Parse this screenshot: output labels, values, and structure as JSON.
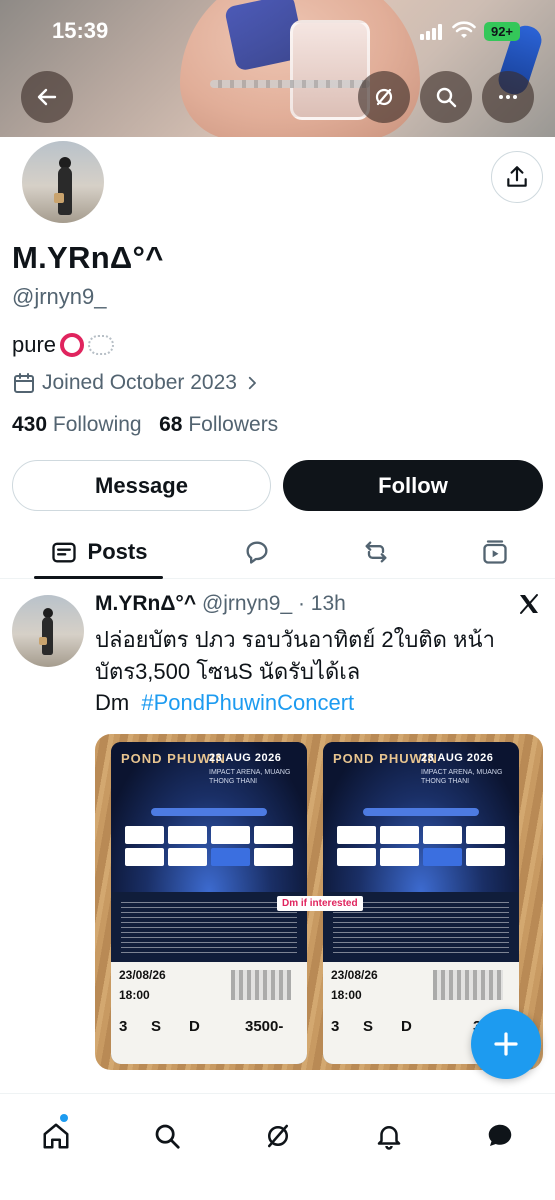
{
  "status_bar": {
    "time": "15:39",
    "battery": "92+"
  },
  "profile": {
    "display_name": "M.YRnΔ°^",
    "handle": "@jrnyn9_",
    "bio": "pure",
    "joined": "Joined October 2023",
    "following_count": "430",
    "following_label": "Following",
    "followers_count": "68",
    "followers_label": "Followers"
  },
  "actions": {
    "message_label": "Message",
    "follow_label": "Follow"
  },
  "tabs": [
    {
      "label": "Posts",
      "icon": "posts-icon",
      "active": true
    },
    {
      "label": "",
      "icon": "replies-icon"
    },
    {
      "label": "",
      "icon": "reposts-icon"
    },
    {
      "label": "",
      "icon": "media-icon"
    }
  ],
  "tweet": {
    "name": "M.YRnΔ°^",
    "handle_time": "@jrnyn9_ · 13h",
    "text": "ปล่อยบัตร ปภว รอบวันอาทิตย์ 2ใบติด หน้าบัตร3,500 โซนS นัดรับได้เล",
    "text2": "Dm",
    "hashtag": "#PondPhuwinConcert",
    "media": {
      "dm_overlay": "Dm if interested",
      "tickets": [
        {
          "logo": "POND PHUWIN",
          "date": "23 AUG 2026",
          "venue": "IMPACT ARENA, MUANG THONG THANI",
          "show_date": "23/08/26",
          "show_time": "18:00",
          "level": "3",
          "zone": "S",
          "row": "D",
          "price": "3500-"
        },
        {
          "logo": "POND PHUWIN",
          "date": "23 AUG 2026",
          "venue": "IMPACT ARENA, MUANG THONG THANI",
          "show_date": "23/08/26",
          "show_time": "18:00",
          "level": "3",
          "zone": "S",
          "row": "D",
          "price": "350"
        }
      ]
    }
  },
  "colors": {
    "accent": "#1d9bf0",
    "text": "#0f1419",
    "muted": "#536471",
    "follow_bg": "#0f1419"
  },
  "bottom_nav": [
    "home-icon",
    "search-icon",
    "grok-icon",
    "notifications-icon",
    "messages-icon"
  ]
}
